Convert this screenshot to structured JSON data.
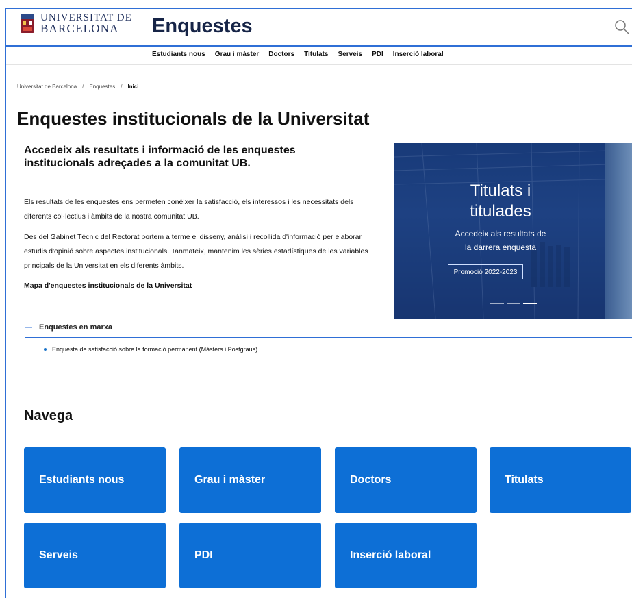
{
  "header": {
    "logo_line1": "UNIVERSITAT DE",
    "logo_line2": "BARCELONA",
    "site_title": "Enquestes",
    "search_icon": "search-icon"
  },
  "nav": {
    "items": [
      "Estudiants nous",
      "Grau i màster",
      "Doctors",
      "Titulats",
      "Serveis",
      "PDI",
      "Inserció laboral"
    ]
  },
  "breadcrumb": {
    "items": [
      "Universitat de Barcelona",
      "Enquestes",
      "Inici"
    ],
    "separator": "/"
  },
  "page": {
    "title": "Enquestes institucionals de la Universitat",
    "intro_heading": "Accedeix als resultats i informació de les enquestes institucionals adreçades a la comunitat UB.",
    "paragraph1": "Els resultats de les enquestes ens permeten conèixer la satisfacció, els interessos i les necessitats dels diferents col·lectius i àmbits de la nostra comunitat UB.",
    "paragraph2": "Des del Gabinet Tècnic del Rectorat portem a terme el disseny, anàlisi i recollida d'informació per elaborar estudis d'opinió sobre aspectes institucionals. Tanmateix, mantenim les sèries estadístiques de les variables principals de la Universitat en els diferents àmbits.",
    "map_link": "Mapa d'enquestes institucionals de la Universitat"
  },
  "hero": {
    "title_line1": "Titulats i",
    "title_line2": "titulades",
    "subtitle_line1": "Accedeix als resultats de",
    "subtitle_line2": "la darrera enquesta",
    "button": "Promoció 2022-2023"
  },
  "ongoing": {
    "heading": "Enquestes en marxa",
    "toggle": "—",
    "items": [
      "Enquesta de satisfacció sobre la formació permanent (Màsters i Postgraus)"
    ]
  },
  "navega": {
    "heading": "Navega",
    "tiles": [
      "Estudiants nous",
      "Grau i màster",
      "Doctors",
      "Titulats",
      "Serveis",
      "PDI",
      "Inserció laboral"
    ]
  },
  "colors": {
    "accent": "#2f6fd6",
    "tile": "#0d6fd6",
    "title": "#162447"
  }
}
